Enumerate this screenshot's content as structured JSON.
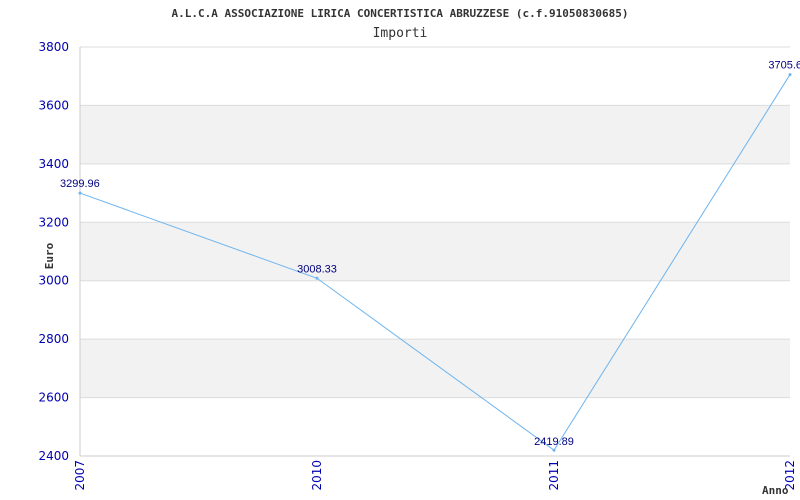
{
  "chart_data": {
    "type": "line",
    "title": "A.L.C.A ASSOCIAZIONE LIRICA CONCERTISTICA ABRUZZESE (c.f.91050830685)",
    "subtitle": "Importi",
    "xlabel": "Anno",
    "ylabel": "Euro",
    "categories": [
      "2007",
      "2010",
      "2011",
      "2012"
    ],
    "series": [
      {
        "values": [
          3299.96,
          3008.33,
          2419.89,
          3705.6
        ],
        "data_labels": [
          "3299.96",
          "3008.33",
          "2419.89",
          "3705.6"
        ]
      }
    ],
    "ylim": [
      2400,
      3800
    ],
    "yticks": [
      "2400",
      "2600",
      "2800",
      "3000",
      "3200",
      "3400",
      "3600",
      "3800"
    ],
    "grid": "horizontal alternating bands",
    "colors": {
      "line": "#6eb4ee",
      "tick_text": "#0000b0",
      "label_text": "#000080",
      "band": "#f2f2f2",
      "grid": "#dcdcdc"
    }
  }
}
